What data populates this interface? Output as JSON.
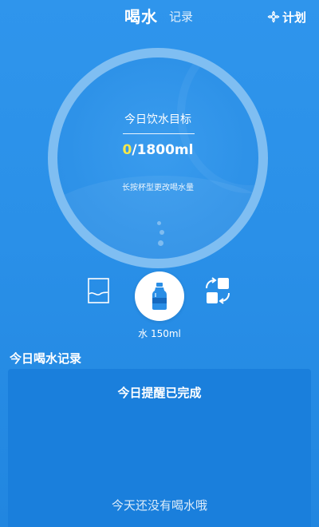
{
  "header": {
    "active_tab": "喝水",
    "inactive_tab": "记录",
    "plan_label": "计划",
    "plan_icon": "flower-gear-icon"
  },
  "goal": {
    "label": "今日饮水目标",
    "current": "0",
    "separator": "/",
    "target": "1800",
    "unit": "ml",
    "hint": "长按杯型更改喝水量",
    "current_color": "#f5e84a"
  },
  "cup": {
    "left_icon": "glass-icon",
    "center_icon": "water-bottle-icon",
    "right_icon": "swap-icon",
    "label": "水 150ml"
  },
  "records": {
    "title": "今日喝水记录",
    "reminder_status": "今日提醒已完成",
    "empty_text": "今天还没有喝水哦"
  },
  "colors": {
    "background": "#2a90e8",
    "ring": "#7fbef2",
    "card": "#1a7fdc",
    "bottle": "#2a8ee6"
  }
}
